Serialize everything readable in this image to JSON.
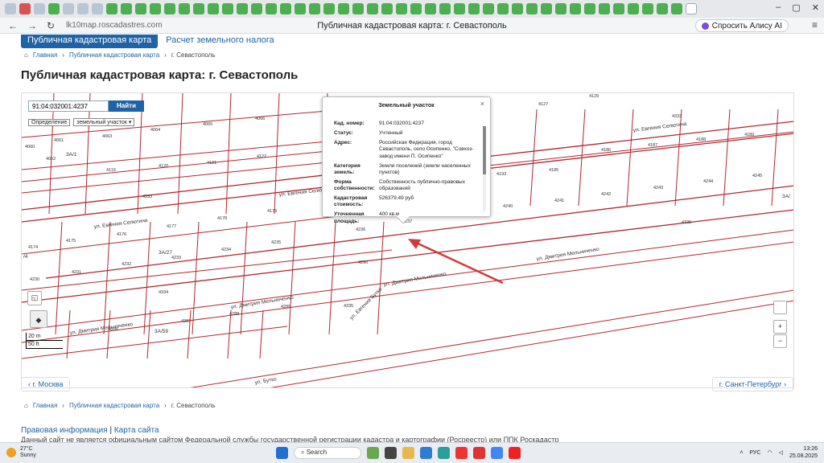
{
  "browser": {
    "title": "Публичная кадастровая карта: г. Севастополь",
    "url": "lk10map.roscadastres.com",
    "alice": "Спросить Алису AI",
    "nav": {
      "back": "←",
      "forward": "→",
      "reload": "↻"
    }
  },
  "site": {
    "btn_map": "Публичная кадастровая карта",
    "link_tax": "Расчет земельного налога",
    "breadcrumb": [
      "Главная",
      "Публичная кадастровая карта",
      "г. Севастополь"
    ],
    "heading": "Публичная кадастровая карта: г. Севастополь"
  },
  "map": {
    "search_value": "91:04:032001:4237",
    "search_button": "Найти",
    "def_label": "Определение",
    "def_value": "земельный участок",
    "scale_top": "20 m",
    "scale_bottom": "50 ft",
    "zoom_in": "+",
    "zoom_out": "−",
    "parcels": [
      "4061",
      "4063",
      "4064",
      "4065",
      "4066",
      "4060",
      "4062",
      "4119",
      "4120",
      "4121",
      "4122",
      "4333",
      "4174",
      "4175",
      "4176",
      "4177",
      "4178",
      "4179",
      "4230",
      "4231",
      "4232",
      "4233",
      "4234",
      "4235",
      "4334",
      "4236",
      "4237",
      "4290",
      "4335",
      "4286",
      "4287",
      "4288",
      "4289",
      "4127",
      "4129",
      "4333",
      "4186",
      "4187",
      "4188",
      "4189",
      "4185",
      "4241",
      "4242",
      "4243",
      "4244",
      "4245",
      "4240",
      "4193",
      "4335",
      "4236"
    ],
    "labels": {
      "l1": "3А/1",
      "l2": "3А/27",
      "l3": "3А/59",
      "l4": "3А/",
      "l5": "/4",
      "l6": "/4"
    },
    "streets": [
      "ул. Евгения Селютина",
      "ул. Евгения Селютина",
      "ул. Евгения Селютина",
      "ул. Дмитрия Мельниченко",
      "ул. Дмитрия Мельниченко",
      "ул. Дмитрия Мельниченко",
      "ул. Дмитрия Мельниченко",
      "ул. Евгения Бутко",
      "ул. Бутко"
    ]
  },
  "popup": {
    "title": "Земельный участок",
    "rows": [
      {
        "k": "Кад. номер:",
        "v": "91:04:032001:4237"
      },
      {
        "k": "Статус:",
        "v": "Учтенный"
      },
      {
        "k": "Адрес:",
        "v": "Российская Федерация, город Севастополь, село Осипенко, \"Совхоз-завод имени П. Осипенко\""
      },
      {
        "k": "Категория земель:",
        "v": "Земли поселений (земли населенных пунктов)"
      },
      {
        "k": "Форма собственности:",
        "v": "Собственность публично-правовых образований"
      },
      {
        "k": "Кадастровая стоимость:",
        "v": "526379.49 руб"
      },
      {
        "k": "Уточненная площадь:",
        "v": "400 кв.м"
      }
    ]
  },
  "pager": {
    "prev": "‹ г. Москва",
    "next": "г. Санкт-Петербург ›"
  },
  "footer": {
    "breadcrumb": [
      "Главная",
      "Публичная кадастровая карта",
      "г. Севастополь"
    ],
    "link_legal": "Правовая информация",
    "sep": "|",
    "link_map": "Карта сайта",
    "disclaimer": "Данный сайт не является официальным сайтом Федеральной службы государственной регистрации кадастра и картографии (Росреестр) или ППК Роскадастр"
  },
  "taskbar": {
    "temp": "27°C",
    "weather": "Sunny",
    "search": "Search",
    "lang": "РУС",
    "time": "13:26",
    "date": "25.08.2025"
  },
  "colors": {
    "parcel": "#b3252d",
    "accent": "#1e63a6",
    "arrow": "#d23a3a"
  }
}
